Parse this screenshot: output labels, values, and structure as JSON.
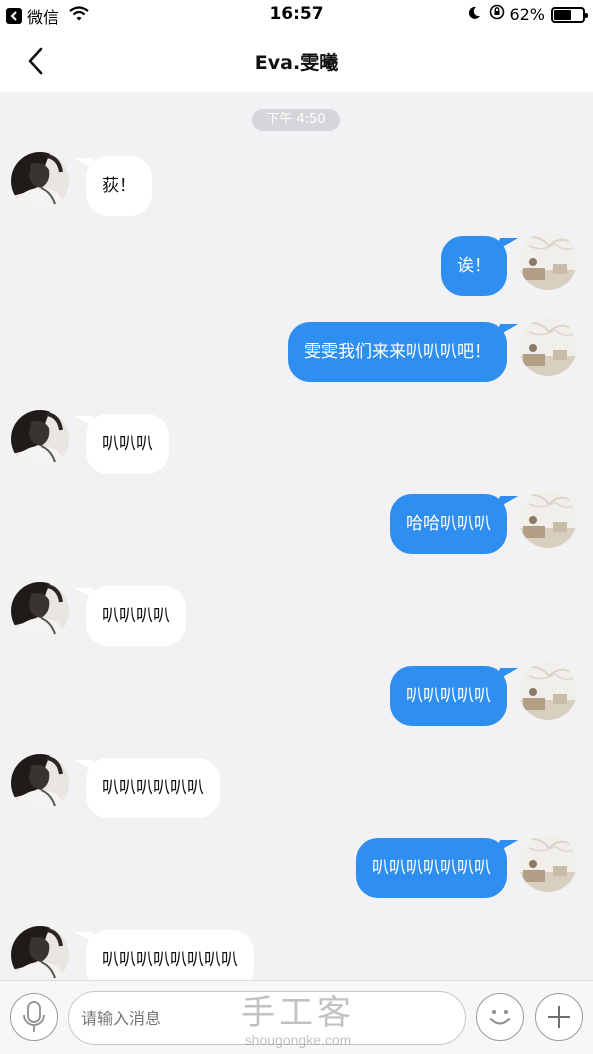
{
  "status_bar": {
    "back_app": "微信",
    "time": "16:57",
    "battery_percent": "62%",
    "battery_level": 0.62,
    "icons": [
      "back-badge-icon",
      "wifi-icon",
      "moon-icon",
      "orientation-lock-icon",
      "battery-icon"
    ]
  },
  "nav": {
    "title": "Eva.雯曦",
    "back_icon": "chevron-left-icon"
  },
  "chat": {
    "timestamp": "下午 4:50",
    "messages": [
      {
        "side": "left",
        "text": "荻！"
      },
      {
        "side": "right",
        "text": "诶！"
      },
      {
        "side": "right",
        "text": "雯雯我们来来叭叭叭吧！"
      },
      {
        "side": "left",
        "text": "叭叭叭"
      },
      {
        "side": "right",
        "text": "哈哈叭叭叭"
      },
      {
        "side": "left",
        "text": "叭叭叭叭"
      },
      {
        "side": "right",
        "text": "叭叭叭叭叭"
      },
      {
        "side": "left",
        "text": "叭叭叭叭叭叭"
      },
      {
        "side": "right",
        "text": "叭叭叭叭叭叭叭"
      },
      {
        "side": "left",
        "text": "叭叭叭叭叭叭叭叭"
      }
    ]
  },
  "input_bar": {
    "placeholder": "请输入消息",
    "icons": [
      "microphone-icon",
      "smiley-icon",
      "plus-icon"
    ]
  },
  "watermark": {
    "main": "手工客",
    "sub": "shougongke.com"
  },
  "colors": {
    "outgoing_bubble": "#2f8ff0",
    "incoming_bubble": "#ffffff",
    "background": "#f2f2f4"
  }
}
